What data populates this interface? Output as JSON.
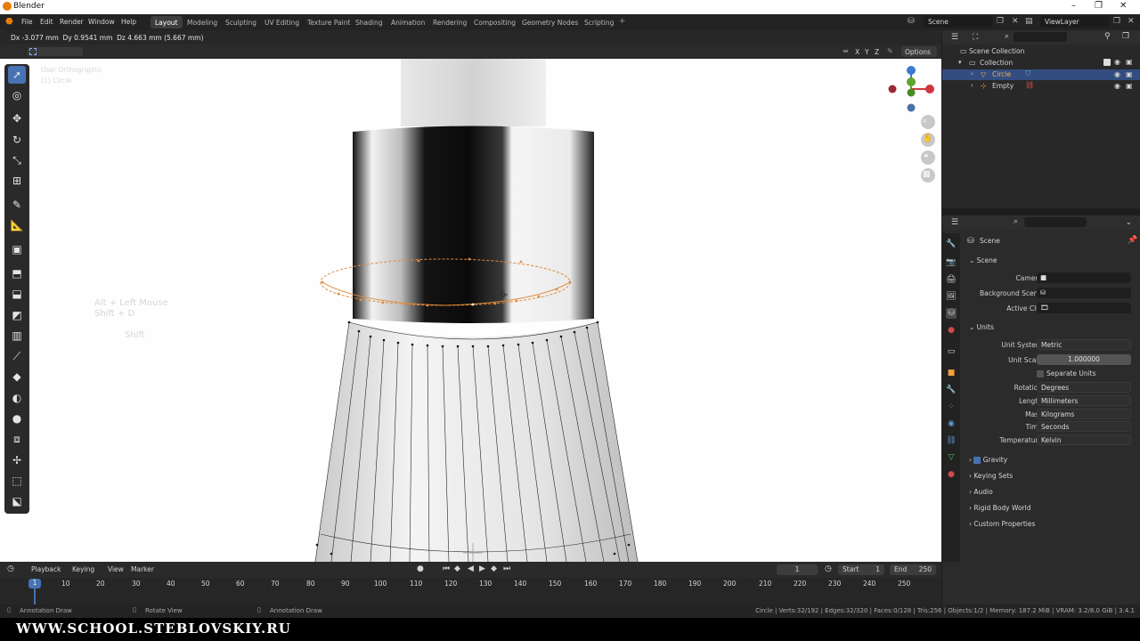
{
  "window": {
    "title": "Blender"
  },
  "menu": [
    "File",
    "Edit",
    "Render",
    "Window",
    "Help"
  ],
  "workspaces": [
    "Layout",
    "Modeling",
    "Sculpting",
    "UV Editing",
    "Texture Paint",
    "Shading",
    "Animation",
    "Rendering",
    "Compositing",
    "Geometry Nodes",
    "Scripting"
  ],
  "scene_field": "Scene",
  "viewlayer_field": "ViewLayer",
  "viewport": {
    "header_text": "Dx -3.077 mm  Dy 0.9541 mm  Dz 4.663 mm (5.667 mm)",
    "options_label": "Options",
    "axes": [
      "X",
      "Y",
      "Z"
    ],
    "view_name": "User Orthographic",
    "object_name": "(1) Circle",
    "key_hint_1": "Alt + Left Mouse",
    "key_hint_2": "Shift + D",
    "key_hint_3": "Shift"
  },
  "outliner": {
    "root": "Scene Collection",
    "collection": "Collection",
    "items": [
      {
        "name": "Circle",
        "selected": true
      },
      {
        "name": "Empty",
        "selected": false
      }
    ]
  },
  "properties": {
    "context": "Scene",
    "scene_section": "Scene",
    "camera_label": "Camera",
    "background_scene_label": "Background Scene",
    "active_clip_label": "Active Clip",
    "units_section": "Units",
    "unit_system_label": "Unit System",
    "unit_system": "Metric",
    "unit_scale_label": "Unit Scale",
    "unit_scale": "1.000000",
    "separate_units": "Separate Units",
    "rotation_label": "Rotation",
    "rotation": "Degrees",
    "length_label": "Length",
    "length": "Millimeters",
    "mass_label": "Mass",
    "mass": "Kilograms",
    "time_label": "Time",
    "time": "Seconds",
    "temperature_label": "Temperature",
    "temperature": "Kelvin",
    "gravity": "Gravity",
    "keying_sets": "Keying Sets",
    "audio": "Audio",
    "rigid_body_world": "Rigid Body World",
    "custom_properties": "Custom Properties"
  },
  "timeline": {
    "menus": [
      "Playback",
      "Keying",
      "View",
      "Marker"
    ],
    "current_frame": "1",
    "start_label": "Start",
    "start": "1",
    "end_label": "End",
    "end": "250",
    "ruler": [
      "1",
      "10",
      "20",
      "30",
      "40",
      "50",
      "60",
      "70",
      "80",
      "90",
      "100",
      "110",
      "120",
      "130",
      "140",
      "150",
      "160",
      "170",
      "180",
      "190",
      "200",
      "210",
      "220",
      "230",
      "240",
      "250"
    ]
  },
  "status": {
    "left_1": "Annotation Draw",
    "left_2": "Rotate View",
    "left_3": "Annotation Draw",
    "right": "Circle | Verts:32/192 | Edges:32/320 | Faces:0/128 | Tris:256 | Objects:1/2 | Memory: 187.2 MiB | VRAM: 3.2/8.0 GiB | 3.4.1"
  },
  "watermark": "WWW.SCHOOL.STEBLOVSKIY.RU",
  "colors": {
    "accent": "#4772b3",
    "selection_orange": "#e08a3c",
    "gizmo_red": "#d0343f",
    "gizmo_green": "#5fa42c",
    "gizmo_blue": "#3b7bd1"
  }
}
